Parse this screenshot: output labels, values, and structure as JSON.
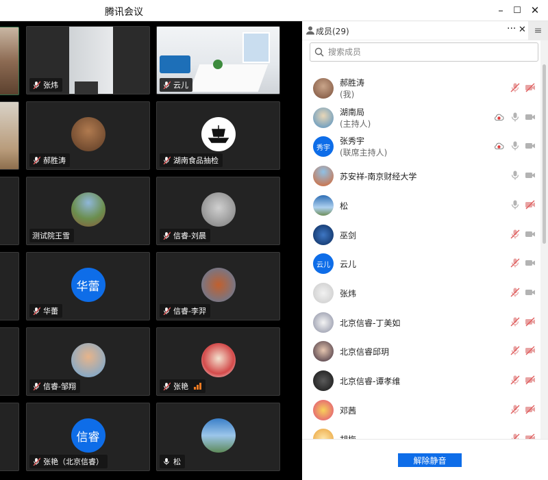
{
  "window": {
    "title": "腾讯会议",
    "minimize": "–",
    "maximize": "☐",
    "close": "✕"
  },
  "video": {
    "tiles": [
      {
        "name": "张炜",
        "mic": "muted",
        "kind": "photo-office"
      },
      {
        "name": "云儿",
        "mic": "muted",
        "kind": "photo-room"
      },
      {
        "name": "郝胜涛",
        "mic": "muted",
        "kind": "avatar"
      },
      {
        "name": "湖南食品抽检",
        "mic": "muted",
        "kind": "avatar"
      },
      {
        "name": "测试院王雪",
        "mic": "none",
        "kind": "avatar"
      },
      {
        "name": "信睿-刘晨",
        "mic": "muted",
        "kind": "avatar"
      },
      {
        "name": "华蕾",
        "mic": "muted",
        "kind": "initials",
        "initials": "华蕾"
      },
      {
        "name": "信睿-李羿",
        "mic": "muted",
        "kind": "avatar"
      },
      {
        "name": "信睿-邹翔",
        "mic": "muted",
        "kind": "avatar"
      },
      {
        "name": "张艳",
        "mic": "muted",
        "kind": "avatar",
        "signal": true
      },
      {
        "name": "张艳（北京信睿）",
        "mic": "muted",
        "kind": "initials",
        "initials": "信睿"
      },
      {
        "name": "松",
        "mic": "on",
        "kind": "avatar"
      }
    ]
  },
  "panel": {
    "title": "成员(29)",
    "more": "···",
    "close": "✕",
    "menu": "≡",
    "search_placeholder": "搜索成员",
    "members": [
      {
        "name": "郝胜涛",
        "role": "(我)",
        "cloud": false,
        "mic": "muted",
        "cam": "off"
      },
      {
        "name": "湖南局",
        "role": "(主持人)",
        "cloud": true,
        "mic": "on",
        "cam": "on"
      },
      {
        "name": "张秀宇",
        "role": "(联席主持人)",
        "cloud": true,
        "mic": "on",
        "cam": "on",
        "initials": "秀宇"
      },
      {
        "name": "苏安祥-南京财经大学",
        "role": "",
        "cloud": false,
        "mic": "on",
        "cam": "on"
      },
      {
        "name": "松",
        "role": "",
        "cloud": false,
        "mic": "on",
        "cam": "off"
      },
      {
        "name": "巫剑",
        "role": "",
        "cloud": false,
        "mic": "muted",
        "cam": "on"
      },
      {
        "name": "云儿",
        "role": "",
        "cloud": false,
        "mic": "muted",
        "cam": "on",
        "initials": "云儿"
      },
      {
        "name": "张炜",
        "role": "",
        "cloud": false,
        "mic": "muted",
        "cam": "on"
      },
      {
        "name": "北京信睿-丁美如",
        "role": "",
        "cloud": false,
        "mic": "muted",
        "cam": "off"
      },
      {
        "name": "北京信睿邱玥",
        "role": "",
        "cloud": false,
        "mic": "muted",
        "cam": "off"
      },
      {
        "name": "北京信睿-谭孝维",
        "role": "",
        "cloud": false,
        "mic": "muted",
        "cam": "off"
      },
      {
        "name": "邓茜",
        "role": "",
        "cloud": false,
        "mic": "muted",
        "cam": "off"
      },
      {
        "name": "胡梅",
        "role": "",
        "cloud": false,
        "mic": "muted",
        "cam": "off"
      }
    ],
    "unmute_label": "解除静音"
  },
  "colors": {
    "accent": "#0e6de8",
    "muted_red": "#e05a5a",
    "icon_gray": "#b3b3b3"
  }
}
